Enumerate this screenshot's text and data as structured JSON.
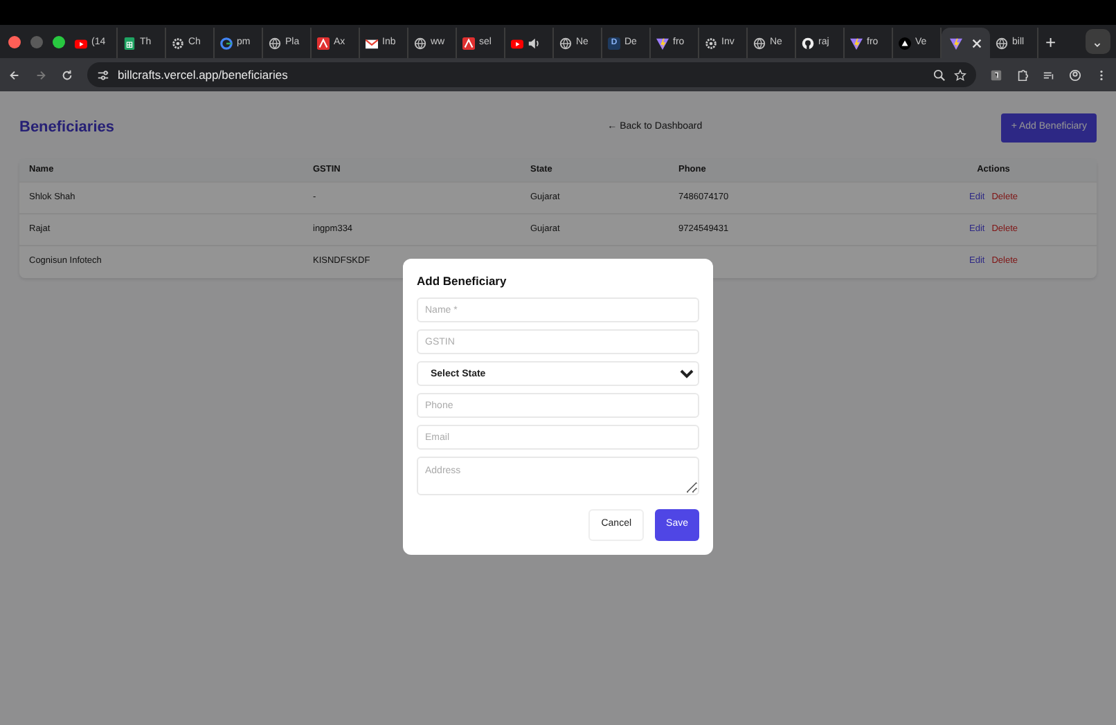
{
  "browser": {
    "tabs": [
      {
        "kind": "youtube",
        "title": "(14",
        "selected": false,
        "audio": false
      },
      {
        "kind": "sheets",
        "title": "Th",
        "selected": false,
        "audio": false
      },
      {
        "kind": "gear",
        "title": "Ch",
        "selected": false,
        "audio": false
      },
      {
        "kind": "google",
        "title": "pm",
        "selected": false,
        "audio": false
      },
      {
        "kind": "globe",
        "title": "Pla",
        "selected": false,
        "audio": false
      },
      {
        "kind": "acrobat",
        "title": "Ax",
        "selected": false,
        "audio": false
      },
      {
        "kind": "gmail",
        "title": "Inb",
        "selected": false,
        "audio": false
      },
      {
        "kind": "globe",
        "title": "ww",
        "selected": false,
        "audio": false
      },
      {
        "kind": "acrobat",
        "title": "sel",
        "selected": false,
        "audio": false
      },
      {
        "kind": "youtube",
        "selected": false,
        "audio": true
      },
      {
        "kind": "globe",
        "title": "Ne",
        "selected": false,
        "audio": false
      },
      {
        "kind": "letter",
        "title": "De",
        "selected": false,
        "audio": false
      },
      {
        "kind": "vite",
        "title": "fro",
        "selected": false,
        "audio": false
      },
      {
        "kind": "gear",
        "title": "Inv",
        "selected": false,
        "audio": false
      },
      {
        "kind": "globe",
        "title": "Ne",
        "selected": false,
        "audio": false
      },
      {
        "kind": "github",
        "title": "raj",
        "selected": false,
        "audio": false
      },
      {
        "kind": "vite",
        "title": "fro",
        "selected": false,
        "audio": false
      },
      {
        "kind": "vercel",
        "title": "Ve",
        "selected": false,
        "audio": false
      },
      {
        "kind": "vite",
        "selected": true,
        "audio": false
      },
      {
        "kind": "globe",
        "title": "bill",
        "selected": false,
        "audio": false
      }
    ],
    "letter_icon_text": "D",
    "new_tab": "+",
    "address": "billcrafts.vercel.app/beneficiaries"
  },
  "page": {
    "title": "Beneficiaries",
    "back_link": "← Back to Dashboard",
    "add_button": "+ Add Beneficiary",
    "table": {
      "columns": [
        "Name",
        "GSTIN",
        "State",
        "Phone",
        "Actions"
      ],
      "rows": [
        {
          "name": "Shlok Shah",
          "gstin": "-",
          "state": "Gujarat",
          "phone": "7486074170",
          "actions": [
            "Edit",
            "Delete"
          ]
        },
        {
          "name": "Rajat",
          "gstin": "ingpm334",
          "state": "Gujarat",
          "phone": "9724549431",
          "actions": [
            "Edit",
            "Delete"
          ]
        },
        {
          "name": "Cognisun Infotech",
          "gstin": "KISNDFSKDF",
          "actions": [
            "Edit",
            "Delete"
          ]
        }
      ]
    }
  },
  "modal": {
    "title": "Add Beneficiary",
    "fields": [
      {
        "kind": "input",
        "placeholder": "Name *"
      },
      {
        "kind": "input",
        "placeholder": "GSTIN"
      },
      {
        "kind": "select",
        "value": "Select State"
      },
      {
        "kind": "input",
        "placeholder": "Phone"
      },
      {
        "kind": "input",
        "placeholder": "Email"
      },
      {
        "kind": "textarea",
        "placeholder": "Address"
      }
    ],
    "buttons": [
      {
        "label": "Cancel",
        "kind": "secondary"
      },
      {
        "label": "Save",
        "kind": "primary"
      }
    ]
  }
}
